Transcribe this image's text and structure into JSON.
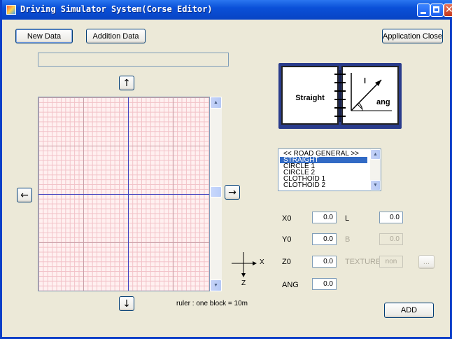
{
  "window": {
    "title": "Driving Simulator System(Corse Editor)"
  },
  "toolbar": {
    "new_data": "New Data",
    "addition_data": "Addition Data",
    "application_close": "Application Close"
  },
  "arrows": {
    "up": "↑",
    "down": "↓",
    "left": "←",
    "right": "→"
  },
  "illustration": {
    "left_label": "Straight",
    "l_label": "l",
    "ang_label": "ang"
  },
  "road_list": {
    "header": "<< ROAD  GENERAL >>",
    "items": [
      "STRAIGHT",
      "CIRCLE 1",
      "CIRCLE 2",
      "CLOTHOID 1",
      "CLOTHOID 2"
    ],
    "selected": "STRAIGHT"
  },
  "params": {
    "x0": {
      "label": "X0",
      "value": "0.0"
    },
    "y0": {
      "label": "Y0",
      "value": "0.0"
    },
    "z0": {
      "label": "Z0",
      "value": "0.0"
    },
    "ang": {
      "label": "ANG",
      "value": "0.0"
    },
    "l": {
      "label": "L",
      "value": "0.0"
    },
    "b": {
      "label": "B",
      "value": "0.0"
    },
    "texture": {
      "label": "TEXTURE",
      "value": "non",
      "browse": "..."
    }
  },
  "axes": {
    "x": "X",
    "z": "Z"
  },
  "ruler": "ruler : one block = 10m",
  "add_button": "ADD"
}
